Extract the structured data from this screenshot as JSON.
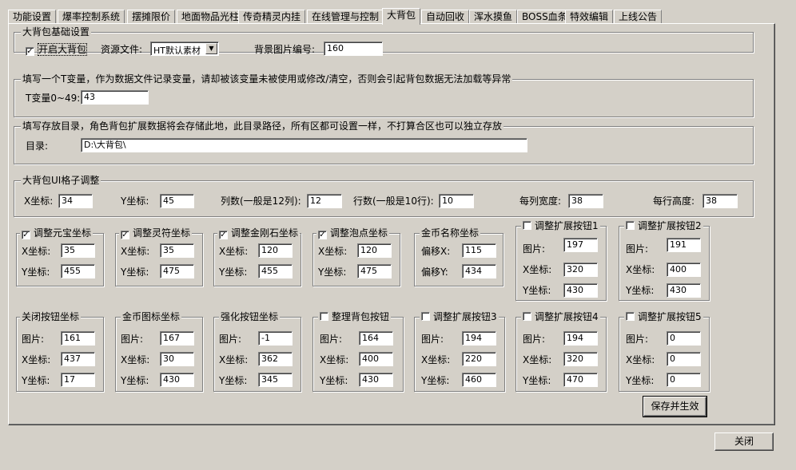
{
  "tabs": [
    "功能设置",
    "爆率控制系统",
    "摆摊限价",
    "地面物品光柱",
    "传奇精灵内挂",
    "在线管理与控制",
    "大背包",
    "自动回收",
    "浑水摸鱼",
    "BOSS血条",
    "特效编辑",
    "上线公告"
  ],
  "active_tab": "大背包",
  "basic": {
    "legend": "大背包基础设置",
    "enable_label": "开启大背包",
    "enable_checked": "✓",
    "resource_label": "资源文件:",
    "resource_value": "HT默认素材",
    "bg_label": "背景图片编号:",
    "bg_value": "160"
  },
  "tvar": {
    "legend": "填写一个T变量，作为数据文件记录变量，请却被该变量未被使用或修改/清空，否则会引起背包数据无法加载等异常",
    "label": "T变量0~49:",
    "value": "43"
  },
  "dir": {
    "legend": "填写存放目录，角色背包扩展数据将会存储此地，此目录路径，所有区都可设置一样，不打算合区也可以独立存放",
    "label": "目录:",
    "value": "D:\\大背包\\"
  },
  "grid": {
    "legend": "大背包UI格子调整",
    "x_label": "X坐标:",
    "x_value": "34",
    "y_label": "Y坐标:",
    "y_value": "45",
    "cols_label": "列数(一般是12列):",
    "cols_value": "12",
    "rows_label": "行数(一般是10行):",
    "rows_value": "10",
    "colw_label": "每列宽度:",
    "colw_value": "38",
    "rowh_label": "每行高度:",
    "rowh_value": "38"
  },
  "row1": [
    {
      "legend": "调整元宝坐标",
      "check": "✓",
      "l1": "X坐标:",
      "v1": "35",
      "l2": "Y坐标:",
      "v2": "455"
    },
    {
      "legend": "调整灵符坐标",
      "check": "✓",
      "l1": "X坐标:",
      "v1": "35",
      "l2": "Y坐标:",
      "v2": "475"
    },
    {
      "legend": "调整金刚石坐标",
      "check": "✓",
      "l1": "X坐标:",
      "v1": "120",
      "l2": "Y坐标:",
      "v2": "455"
    },
    {
      "legend": "调整泡点坐标",
      "check": "✓",
      "l1": "X坐标:",
      "v1": "120",
      "l2": "Y坐标:",
      "v2": "475"
    },
    {
      "legend": "金币名称坐标",
      "l1": "偏移X:",
      "v1": "115",
      "l2": "偏移Y:",
      "v2": "434"
    }
  ],
  "ext1": {
    "legend": "调整扩展按钮1",
    "l0": "图片:",
    "v0": "197",
    "l1": "X坐标:",
    "v1": "320",
    "l2": "Y坐标:",
    "v2": "430"
  },
  "ext2": {
    "legend": "调整扩展按钮2",
    "l0": "图片:",
    "v0": "191",
    "l1": "X坐标:",
    "v1": "400",
    "l2": "Y坐标:",
    "v2": "430"
  },
  "row2": [
    {
      "legend": "关闭按钮坐标",
      "l0": "图片:",
      "v0": "161",
      "l1": "X坐标:",
      "v1": "437",
      "l2": "Y坐标:",
      "v2": "17"
    },
    {
      "legend": "金币图标坐标",
      "l0": "图片:",
      "v0": "167",
      "l1": "X坐标:",
      "v1": "30",
      "l2": "Y坐标:",
      "v2": "430"
    },
    {
      "legend": "强化按钮坐标",
      "l0": "图片:",
      "v0": "-1",
      "l1": "X坐标:",
      "v1": "362",
      "l2": "Y坐标:",
      "v2": "345"
    },
    {
      "legend": "整理背包按钮",
      "l0": "图片:",
      "v0": "164",
      "l1": "X坐标:",
      "v1": "400",
      "l2": "Y坐标:",
      "v2": "430"
    },
    {
      "legend": "调整扩展按钮3",
      "l0": "图片:",
      "v0": "194",
      "l1": "X坐标:",
      "v1": "220",
      "l2": "Y坐标:",
      "v2": "460"
    },
    {
      "legend": "调整扩展按钮4",
      "l0": "图片:",
      "v0": "194",
      "l1": "X坐标:",
      "v1": "320",
      "l2": "Y坐标:",
      "v2": "470"
    },
    {
      "legend": "调整扩展按钮5",
      "l0": "图片:",
      "v0": "0",
      "l1": "X坐标:",
      "v1": "0",
      "l2": "Y坐标:",
      "v2": "0"
    }
  ],
  "save_label": "保存并生效",
  "close_label": "关闭"
}
